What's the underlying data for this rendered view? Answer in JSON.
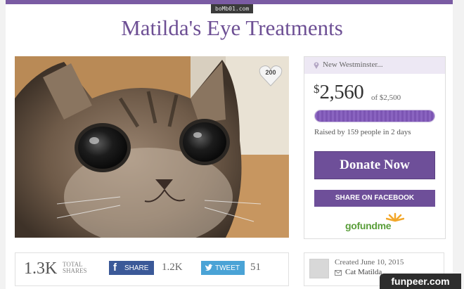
{
  "watermark_top": "boMb01.com",
  "title": "Matilda's Eye Treatments",
  "photo": {
    "alt": "cat-photo",
    "heart_count": "200"
  },
  "sidebar": {
    "location": "New Westminster...",
    "dollar_sign": "$",
    "amount": "2,560",
    "goal": "of $2,500",
    "progress": 1.0,
    "raised_text": "Raised by 159 people in 2 days",
    "donate_label": "Donate Now",
    "share_facebook_label": "SHARE ON FACEBOOK",
    "brand": "gofundme"
  },
  "stats": {
    "total_shares": "1.3K",
    "total_shares_label_1": "TOTAL",
    "total_shares_label_2": "SHARES",
    "facebook_label": "SHARE",
    "facebook_count": "1.2K",
    "tweet_label": "TWEET",
    "tweet_count": "51"
  },
  "creator": {
    "created": "Created June 10, 2015",
    "name": "Cat Matilda"
  },
  "watermark_br": "funpeer.com",
  "colors": {
    "brand_purple": "#6e4f99",
    "title_purple": "#6d4f94",
    "facebook": "#3b5998",
    "twitter": "#4aa3d6",
    "gofundme_green": "#5a9e3a"
  }
}
